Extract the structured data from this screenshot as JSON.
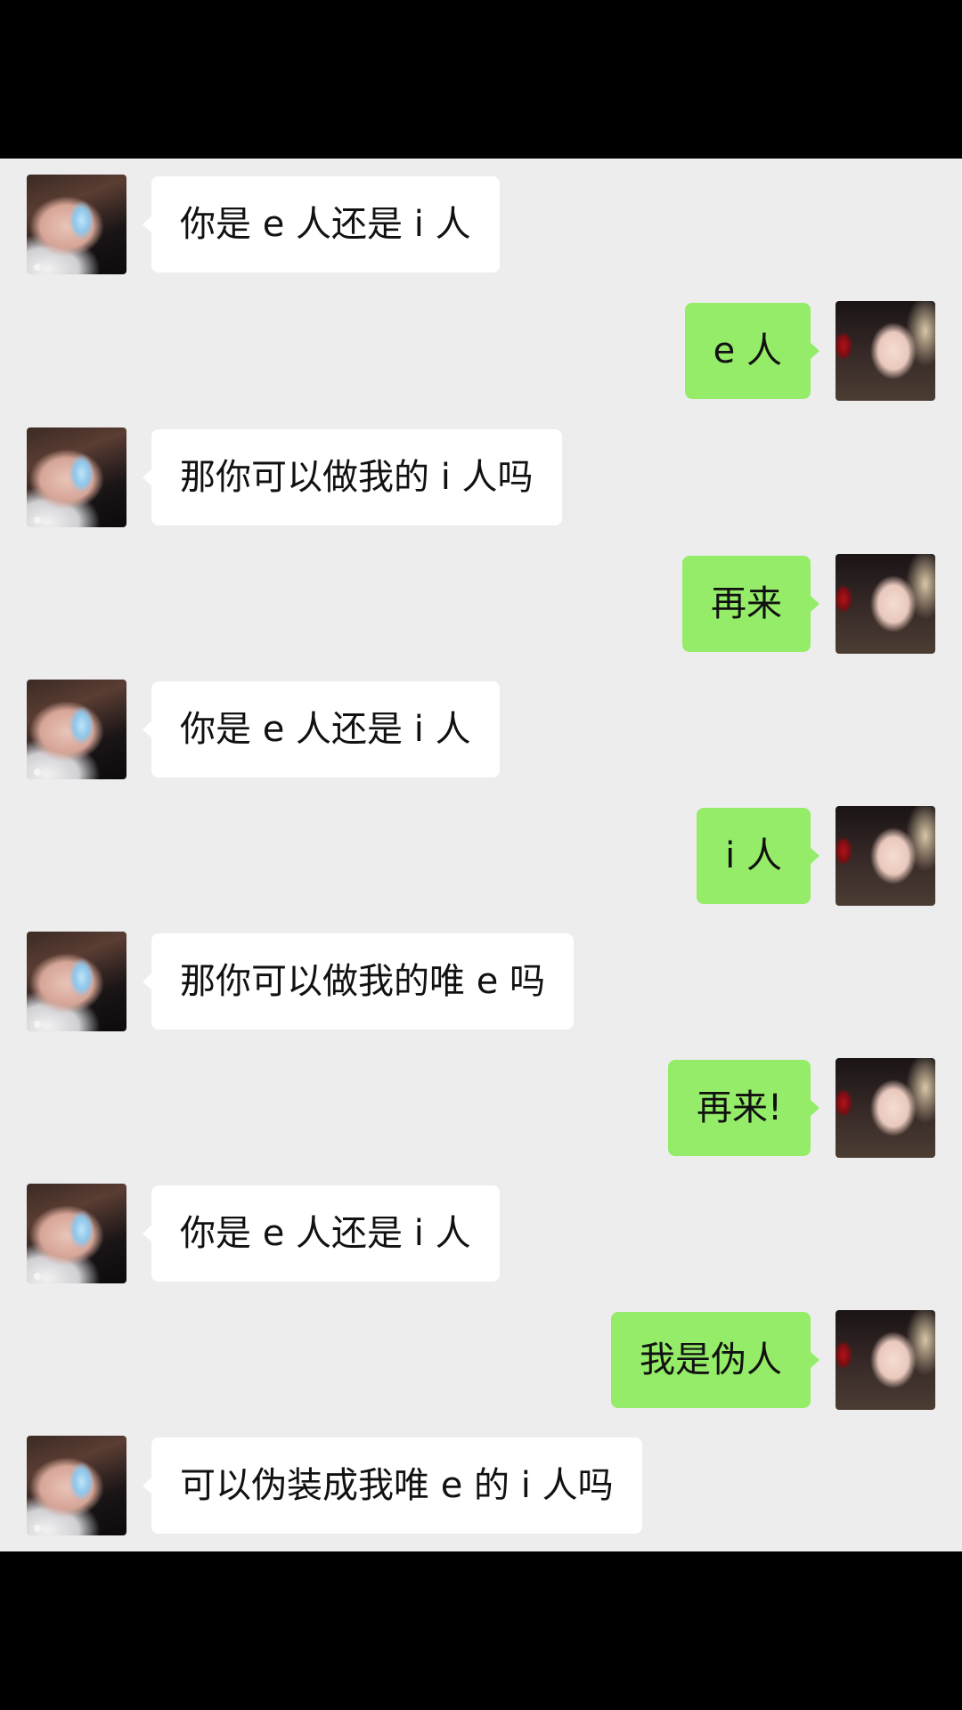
{
  "messages": [
    {
      "sender": "them",
      "text": "你是 e 人还是 i 人"
    },
    {
      "sender": "me",
      "text": "e 人"
    },
    {
      "sender": "them",
      "text": "那你可以做我的 i 人吗"
    },
    {
      "sender": "me",
      "text": "再来"
    },
    {
      "sender": "them",
      "text": "你是 e 人还是 i 人"
    },
    {
      "sender": "me",
      "text": "i 人"
    },
    {
      "sender": "them",
      "text": "那你可以做我的唯 e 吗"
    },
    {
      "sender": "me",
      "text": "再来!"
    },
    {
      "sender": "them",
      "text": "你是 e 人还是 i 人"
    },
    {
      "sender": "me",
      "text": "我是伪人"
    },
    {
      "sender": "them",
      "text": "可以伪装成我唯 e 的 i 人吗"
    }
  ],
  "colors": {
    "chat_background": "#ededed",
    "incoming_bubble": "#ffffff",
    "outgoing_bubble": "#95ec69",
    "letterbox": "#000000"
  }
}
